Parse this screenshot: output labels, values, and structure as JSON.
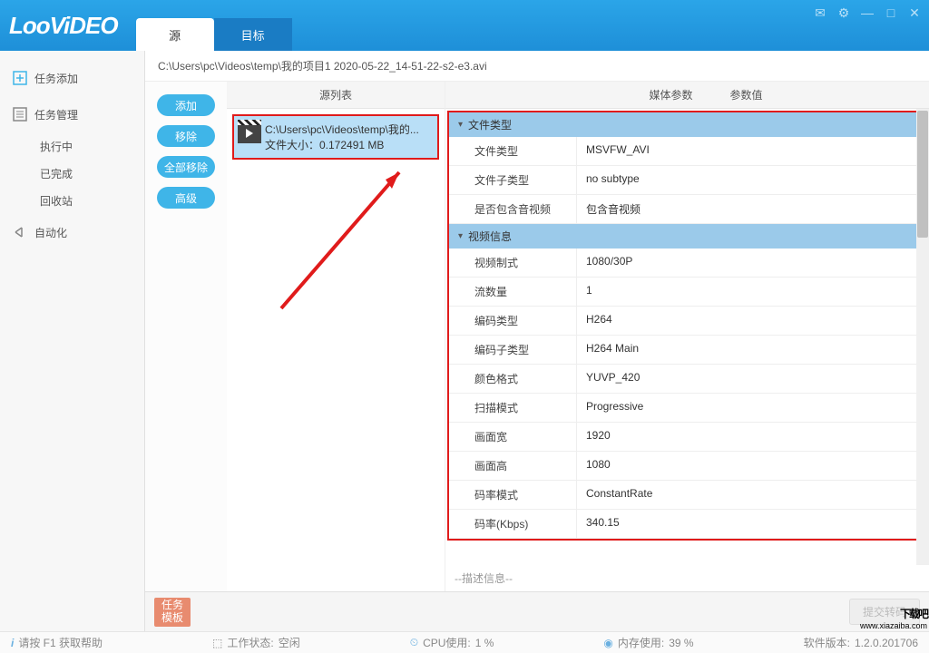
{
  "logo": "LooViDEO",
  "tabs": {
    "source": "源",
    "target": "目标"
  },
  "sidebar": {
    "add_task": "任务添加",
    "manage": "任务管理",
    "running": "执行中",
    "done": "已完成",
    "trash": "回收站",
    "auto": "自动化"
  },
  "path": "C:\\Users\\pc\\Videos\\temp\\我的项目1 2020-05-22_14-51-22-s2-e3.avi",
  "pills": {
    "add": "添加",
    "remove": "移除",
    "remove_all": "全部移除",
    "advanced": "高级"
  },
  "headers": {
    "source_list": "源列表",
    "media_param": "媒体参数",
    "param_value": "参数值"
  },
  "source_item": {
    "path": "C:\\Users\\pc\\Videos\\temp\\我的...",
    "size_label": "文件大小：0.172491 MB"
  },
  "groups": {
    "file_type": "文件类型",
    "video_info": "视频信息"
  },
  "params": [
    {
      "label": "文件类型",
      "value": "MSVFW_AVI"
    },
    {
      "label": "文件子类型",
      "value": "no subtype"
    },
    {
      "label": "是否包含音视频",
      "value": "包含音视频"
    }
  ],
  "video_params": [
    {
      "label": "视频制式",
      "value": "1080/30P"
    },
    {
      "label": "流数量",
      "value": "1"
    },
    {
      "label": "编码类型",
      "value": "H264"
    },
    {
      "label": "编码子类型",
      "value": "H264 Main"
    },
    {
      "label": "颜色格式",
      "value": "YUVP_420"
    },
    {
      "label": "扫描模式",
      "value": "Progressive"
    },
    {
      "label": "画面宽",
      "value": "1920"
    },
    {
      "label": "画面高",
      "value": "1080"
    },
    {
      "label": "码率模式",
      "value": "ConstantRate"
    },
    {
      "label": "码率(Kbps)",
      "value": "340.15"
    }
  ],
  "desc": "--描述信息--",
  "task_template": {
    "l1": "任务",
    "l2": "模板"
  },
  "submit": "提交转码",
  "status": {
    "help": "请按 F1 获取帮助",
    "work_label": "工作状态:",
    "work_value": "空闲",
    "cpu_label": "CPU使用:",
    "cpu_value": "1 %",
    "mem_label": "内存使用:",
    "mem_value": "39 %",
    "ver_label": "软件版本:",
    "ver_value": "1.2.0.201706"
  },
  "watermark": {
    "text": "下载吧",
    "url": "www.xiazaiba.com"
  }
}
